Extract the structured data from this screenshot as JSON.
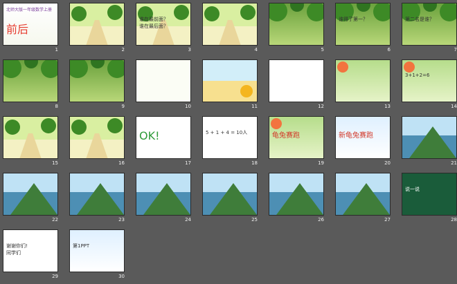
{
  "app": {
    "view": "slide-sorter"
  },
  "colors": {
    "background": "#5a5a5a",
    "slide_border": "#2a2a2a",
    "number": "#f0f0f0"
  },
  "slides": [
    {
      "number": "1",
      "theme": "title",
      "texts": [
        "北师大版一年级数学上册",
        "前后"
      ]
    },
    {
      "number": "2",
      "theme": "street",
      "texts": []
    },
    {
      "number": "3",
      "theme": "street",
      "texts": [
        "谁在最前面？",
        "谁在最后面？"
      ]
    },
    {
      "number": "4",
      "theme": "street",
      "texts": []
    },
    {
      "number": "5",
      "theme": "forest",
      "texts": []
    },
    {
      "number": "6",
      "theme": "forest",
      "texts": [
        "谁得了第一？"
      ]
    },
    {
      "number": "7",
      "theme": "forest",
      "texts": [
        "第二名是谁？"
      ]
    },
    {
      "number": "8",
      "theme": "forest",
      "texts": []
    },
    {
      "number": "9",
      "theme": "forest",
      "texts": []
    },
    {
      "number": "10",
      "theme": "card",
      "texts": []
    },
    {
      "number": "11",
      "theme": "field",
      "texts": []
    },
    {
      "number": "12",
      "theme": "white",
      "texts": []
    },
    {
      "number": "13",
      "theme": "green",
      "texts": []
    },
    {
      "number": "14",
      "theme": "green",
      "texts": [
        "3+1+2=6"
      ]
    },
    {
      "number": "15",
      "theme": "street",
      "texts": []
    },
    {
      "number": "16",
      "theme": "street",
      "texts": []
    },
    {
      "number": "17",
      "theme": "white",
      "texts": [
        "OK!"
      ]
    },
    {
      "number": "18",
      "theme": "white",
      "texts": [
        "5 + 1 + 4 = 10人"
      ]
    },
    {
      "number": "19",
      "theme": "green",
      "texts": [
        "龟兔赛跑"
      ]
    },
    {
      "number": "20",
      "theme": "blue",
      "texts": [
        "新龟兔赛跑"
      ]
    },
    {
      "number": "21",
      "theme": "mountain",
      "texts": []
    },
    {
      "number": "22",
      "theme": "mountain",
      "texts": []
    },
    {
      "number": "23",
      "theme": "mountain",
      "texts": []
    },
    {
      "number": "24",
      "theme": "mountain",
      "texts": []
    },
    {
      "number": "25",
      "theme": "mountain",
      "texts": []
    },
    {
      "number": "26",
      "theme": "mountain",
      "texts": []
    },
    {
      "number": "27",
      "theme": "mountain",
      "texts": []
    },
    {
      "number": "28",
      "theme": "board",
      "texts": [
        "说一说"
      ]
    },
    {
      "number": "29",
      "theme": "white",
      "texts": [
        "谢谢你们!",
        "同学们"
      ]
    },
    {
      "number": "30",
      "theme": "blue",
      "texts": [
        "第1PPT"
      ]
    }
  ]
}
